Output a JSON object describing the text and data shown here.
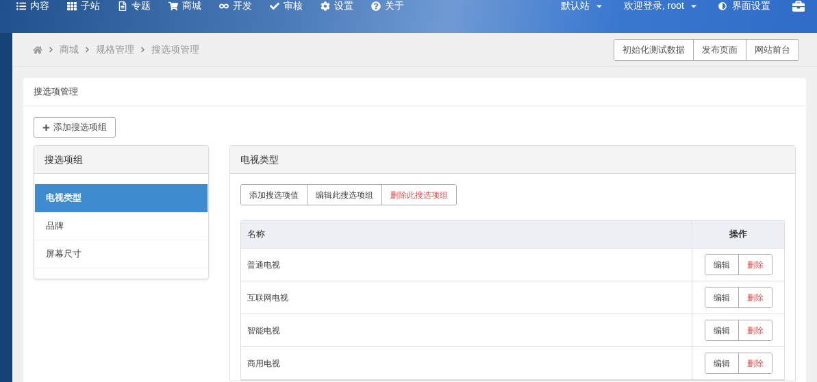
{
  "nav": {
    "items": [
      "内容",
      "子站",
      "专题",
      "商城",
      "开发",
      "审核",
      "设置",
      "关于"
    ],
    "right": [
      {
        "label": "默认站",
        "kind": "dropdown"
      },
      {
        "label": "欢迎登录, root",
        "kind": "dropdown"
      },
      {
        "label": "界面设置",
        "kind": "link"
      }
    ]
  },
  "breadcrumb": [
    "商城",
    "规格管理",
    "搜选项管理"
  ],
  "top_actions": [
    "初始化测试数据",
    "发布页面",
    "网站前台"
  ],
  "card": {
    "title": "搜选项管理",
    "add_button": "添加搜选项组",
    "groups": {
      "title": "搜选项组",
      "items": [
        {
          "label": "电视类型",
          "selected": true
        },
        {
          "label": "品牌",
          "selected": false
        },
        {
          "label": "屏幕尺寸",
          "selected": false
        }
      ]
    },
    "detail": {
      "title": "电视类型",
      "actions": [
        {
          "label": "添加搜选项值",
          "kind": "normal"
        },
        {
          "label": "编辑此搜选项组",
          "kind": "normal"
        },
        {
          "label": "删除此搜选项组",
          "kind": "danger"
        }
      ],
      "table": {
        "columns": [
          "名称",
          "操作"
        ],
        "rows": [
          {
            "name": "普通电视",
            "edit": "编辑",
            "delete": "删除"
          },
          {
            "name": "互联网电视",
            "edit": "编辑",
            "delete": "删除"
          },
          {
            "name": "智能电视",
            "edit": "编辑",
            "delete": "删除"
          },
          {
            "name": "商用电视",
            "edit": "编辑",
            "delete": "删除"
          }
        ]
      }
    }
  }
}
